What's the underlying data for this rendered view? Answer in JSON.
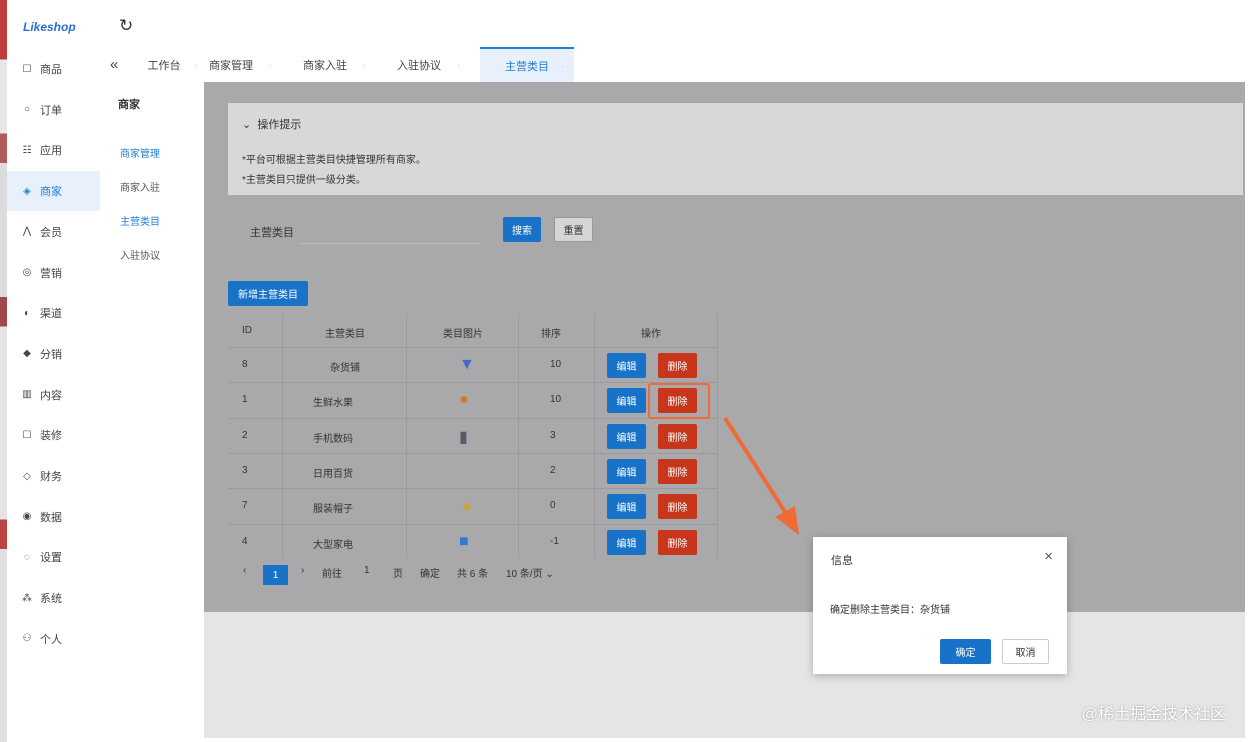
{
  "app": {
    "logo": "Likeshop"
  },
  "topbar": {
    "refresh_icon": "refresh-icon"
  },
  "sidebar": {
    "items": [
      {
        "icon": "cart-icon",
        "glyph": "☐",
        "label": "商品"
      },
      {
        "icon": "order-icon",
        "glyph": "○",
        "label": "订单"
      },
      {
        "icon": "app-icon",
        "glyph": "☷",
        "label": "应用"
      },
      {
        "icon": "shop-icon",
        "glyph": "◈",
        "label": "商家"
      },
      {
        "icon": "user-icon",
        "glyph": "⋀",
        "label": "会员"
      },
      {
        "icon": "marketing-icon",
        "glyph": "◎",
        "label": "营销"
      },
      {
        "icon": "channel-icon",
        "glyph": "◐",
        "label": "渠道"
      },
      {
        "icon": "distribution-icon",
        "glyph": "◆",
        "label": "分销"
      },
      {
        "icon": "content-icon",
        "glyph": "▥",
        "label": "内容"
      },
      {
        "icon": "decorate-icon",
        "glyph": "☐",
        "label": "装修"
      },
      {
        "icon": "finance-icon",
        "glyph": "◇",
        "label": "财务"
      },
      {
        "icon": "data-icon",
        "glyph": "◉",
        "label": "数据"
      },
      {
        "icon": "settings-icon",
        "glyph": "◌",
        "label": "设置"
      },
      {
        "icon": "system-icon",
        "glyph": "⁂",
        "label": "系统"
      },
      {
        "icon": "person-icon",
        "glyph": "⚇",
        "label": "个人"
      }
    ]
  },
  "subnav": {
    "title": "商家",
    "items": [
      "商家管理",
      "商家入驻",
      "主营类目",
      "入驻协议"
    ]
  },
  "tabs": [
    "工作台",
    "商家管理",
    "商家入驻",
    "入驻协议",
    "主营类目"
  ],
  "tips": {
    "header": "操作提示",
    "lines": [
      "*平台可根据主营类目快捷管理所有商家。",
      "*主营类目只提供一级分类。"
    ]
  },
  "search": {
    "label": "主营类目",
    "search_btn": "搜索",
    "reset_btn": "重置"
  },
  "add_button": "新增主营类目",
  "table": {
    "headers": [
      "ID",
      "主营类目",
      "类目图片",
      "排序",
      "操作"
    ],
    "edit_label": "编辑",
    "delete_label": "删除",
    "rows": [
      {
        "id": "8",
        "name": "杂货铺",
        "icon": "shirt-icon",
        "sort": "10"
      },
      {
        "id": "1",
        "name": "生鲜水果",
        "icon": "fruit-icon",
        "sort": "10"
      },
      {
        "id": "2",
        "name": "手机数码",
        "icon": "phone-icon",
        "sort": "3"
      },
      {
        "id": "3",
        "name": "日用百货",
        "icon": "",
        "sort": "2"
      },
      {
        "id": "7",
        "name": "服装帽子",
        "icon": "hat-icon",
        "sort": "0"
      },
      {
        "id": "4",
        "name": "大型家电",
        "icon": "appliance-icon",
        "sort": "-1"
      }
    ]
  },
  "pagination": {
    "prev": "‹",
    "current": "1",
    "next": "›",
    "goto_label": "前往",
    "goto_value": "1",
    "page_unit": "页",
    "confirm": "确定",
    "total": "共 6 条",
    "page_size": "10 条/页"
  },
  "dialog": {
    "title": "信息",
    "message": "确定删除主营类目：杂货铺",
    "ok": "确定",
    "cancel": "取消"
  },
  "watermark": "@稀土掘金技术社区",
  "colors": {
    "primary": "#1873c8",
    "danger": "#c7351a",
    "highlight": "#ef6a35"
  }
}
